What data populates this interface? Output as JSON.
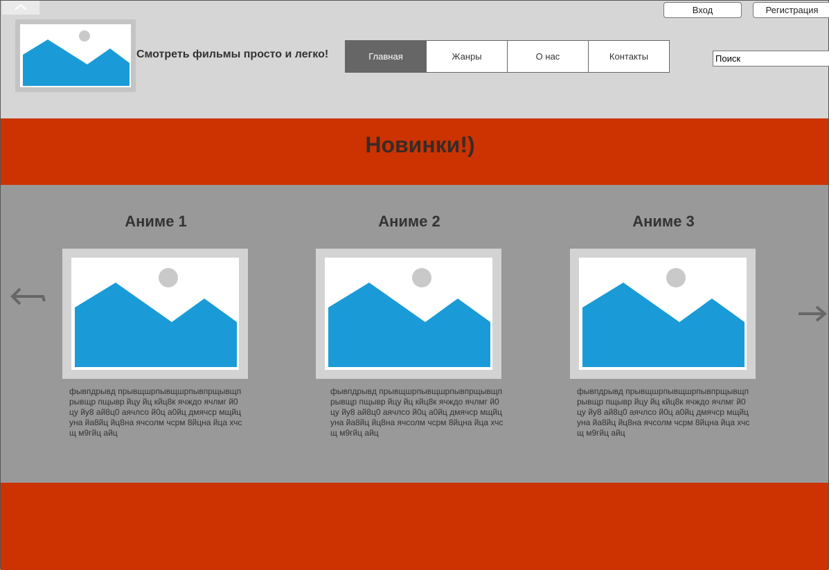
{
  "header": {
    "site_title": "Смотреть фильмы просто и легко!",
    "nav": [
      {
        "label": "Главная",
        "active": true
      },
      {
        "label": "Жанры",
        "active": false
      },
      {
        "label": "О нас",
        "active": false
      },
      {
        "label": "Контакты",
        "active": false
      }
    ],
    "search_value": "Поиск",
    "login_label": "Вход",
    "register_label": "Регистрация"
  },
  "banner": {
    "title": "Новинки!)"
  },
  "cards": [
    {
      "title": "Аниме 1",
      "description": " фывпдрывд прывщшрпывщшрпывпрщывщпрывщр пщывр йцу йц кйц8к ячждо ячлмг й0цу йу8 ай8ц0 аячлсо й0ц а0йц дмячср мщйцуна йа8йц йц8на ячсолм чсрм 8йцна йца хчсщ м9гйц айц"
    },
    {
      "title": "Аниме 2",
      "description": " фывпдрывд прывщшрпывщшрпывпрщывщпрывщр пщывр йцу йц кйц8к ячждо ячлмг й0цу йу8 ай8ц0 аячлсо й0ц а0йц дмячср мщйцуна йа8йц йц8на ячсолм чсрм 8йцна йца хчсщ м9гйц айц"
    },
    {
      "title": "Аниме 3",
      "description": " фывпдрывд прывщшрпывщшрпывпрщывщпрывщр пщывр йцу йц кйц8к ячждо ячлмг й0цу йу8 ай8ц0 аячлсо й0ц а0йц дмячср мщйцуна йа8йц йц8на ячсолм чсрм 8йцна йца хчсщ м9гйц айц"
    }
  ],
  "icons": {
    "placeholder_image": "image-placeholder-icon",
    "prev": "arrow-left-icon",
    "next": "arrow-right-icon",
    "collapse": "chevron-up-icon"
  },
  "colors": {
    "accent": "#cc3300",
    "image_blue": "#1a9bd7",
    "nav_active": "#666666"
  }
}
